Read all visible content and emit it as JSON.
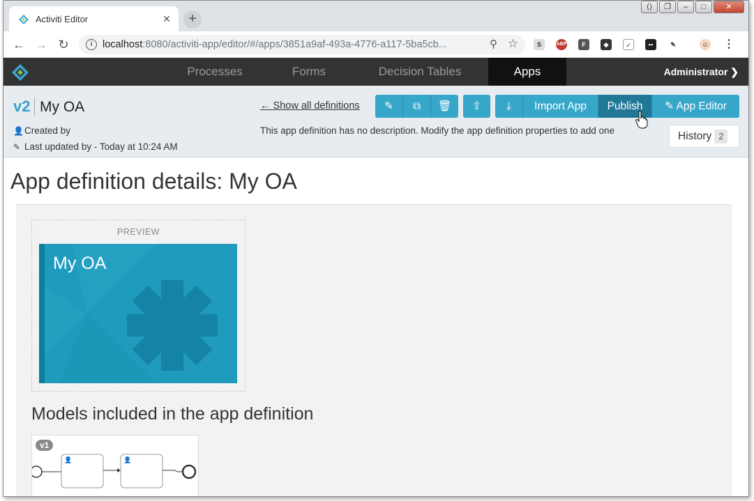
{
  "browser": {
    "tab_title": "Activiti Editor",
    "tab_close": "✕",
    "new_tab": "+",
    "url_host": "localhost",
    "url_path": ":8080/activiti-app/editor/#/apps/3851a9af-493a-4776-a117-5ba5cb...",
    "extensions": [
      "S",
      "ABP",
      "F"
    ]
  },
  "nav": {
    "items": [
      "Processes",
      "Forms",
      "Decision Tables",
      "Apps"
    ],
    "active": "Apps",
    "user": "Administrator"
  },
  "header": {
    "version": "v2",
    "title": "My OA",
    "created_by": "Created by",
    "last_updated": "Last updated by - Today at 10:24 AM",
    "show_all": "← Show all definitions",
    "description": "This app definition has no description. Modify the app definition properties to add one",
    "buttons": {
      "import": "Import App",
      "publish": "Publish",
      "app_editor": "App Editor"
    },
    "history_label": "History",
    "history_count": "2"
  },
  "main": {
    "page_title": "App definition details: My OA",
    "preview_label": "PREVIEW",
    "tile_name": "My OA",
    "models_title": "Models included in the app definition",
    "model_version": "v1"
  },
  "colors": {
    "accent": "#36a6c9",
    "accent_dark": "#217896",
    "tile": "#1f9bbd",
    "navbar": "#333333"
  }
}
